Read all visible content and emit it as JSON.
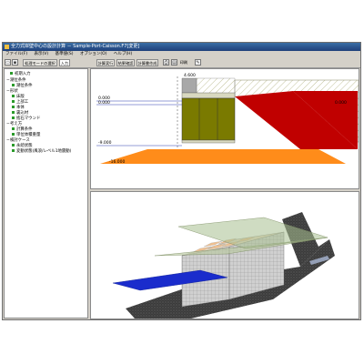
{
  "window": {
    "title": "全力式岸壁中心の設計計算 － Sample-Port-Caisson.F7[変更]"
  },
  "menu": [
    "ファイル(F)",
    "表示(V)",
    "基準値(S)",
    "オプション(O)",
    "ヘルプ(H)"
  ],
  "toolbar": {
    "mode_label": "処理モードの選択",
    "input_label": "入力",
    "compute_label": "計算実行",
    "result_label": "結果確認",
    "report_label": "計算書作成",
    "printer_label": "印刷"
  },
  "tree": {
    "items": [
      {
        "label": "初期入力",
        "level": 0
      },
      {
        "label": "潮位条件",
        "level": 0
      },
      {
        "label": "潮位条件",
        "level": 1
      },
      {
        "label": "形状",
        "level": 0
      },
      {
        "label": "床版",
        "level": 1
      },
      {
        "label": "上部工",
        "level": 1
      },
      {
        "label": "本体",
        "level": 1
      },
      {
        "label": "裏込材",
        "level": 1
      },
      {
        "label": "捨石マウンド",
        "level": 1
      },
      {
        "label": "考え方",
        "level": 0
      },
      {
        "label": "計算条件",
        "level": 1
      },
      {
        "label": "単位体積重量",
        "level": 1
      },
      {
        "label": "検討ケース",
        "level": 0
      },
      {
        "label": "永続状態",
        "level": 1
      },
      {
        "label": "変動状態(風浪/レベル1地震動)",
        "level": 1
      }
    ]
  },
  "view2d": {
    "labels": {
      "crown": "4.600",
      "hwl": "0.000",
      "lwl": "0.000",
      "right": "0.000",
      "base": "-9.000",
      "bottom": "-16.000"
    }
  },
  "colors": {
    "caisson": "#7a7a00",
    "backfill": "#c00000",
    "mound": "#ff8c1a",
    "water": "#1a2ccc",
    "seabed": "#3a3a3a"
  }
}
